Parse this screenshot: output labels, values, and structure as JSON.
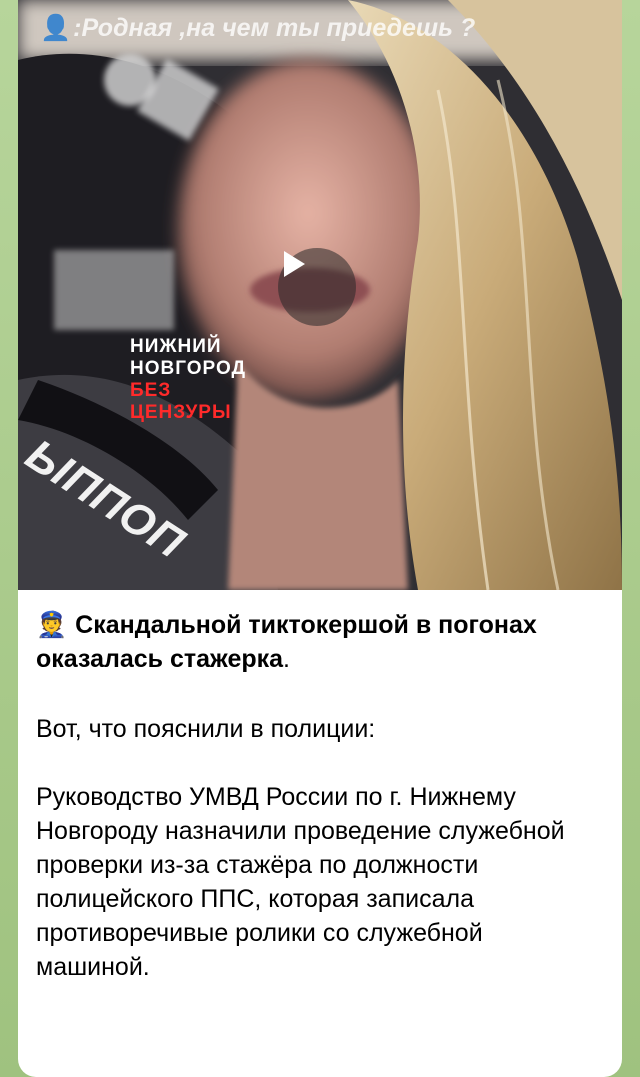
{
  "video": {
    "overlay_emoji": "👤",
    "overlay_caption": ":Родная ,на чем ты приедешь ?",
    "watermark_line1": "НИЖНИЙ",
    "watermark_line2": "НОВГОРОД",
    "watermark_line3": "БЕЗ",
    "watermark_line4": "ЦЕНЗУРЫ",
    "patch_text": "ЫППОП",
    "play_icon": "play-icon"
  },
  "post": {
    "headline_emoji": "👮",
    "headline": "Скандальной тиктокершой в погонах оказалась стажерка",
    "headline_end": ".",
    "paragraph1": "Вот, что пояснили в полиции:",
    "paragraph2": "Руководство УМВД России по г. Нижнему Новгороду назначили проведение служебной проверки из-за стажёра по должности полицейского ППС, которая записала противоречивые ролики со служебной машиной."
  },
  "colors": {
    "chat_background": "#a9c98f",
    "bubble": "#ffffff",
    "watermark_red": "#ff2a2a"
  }
}
